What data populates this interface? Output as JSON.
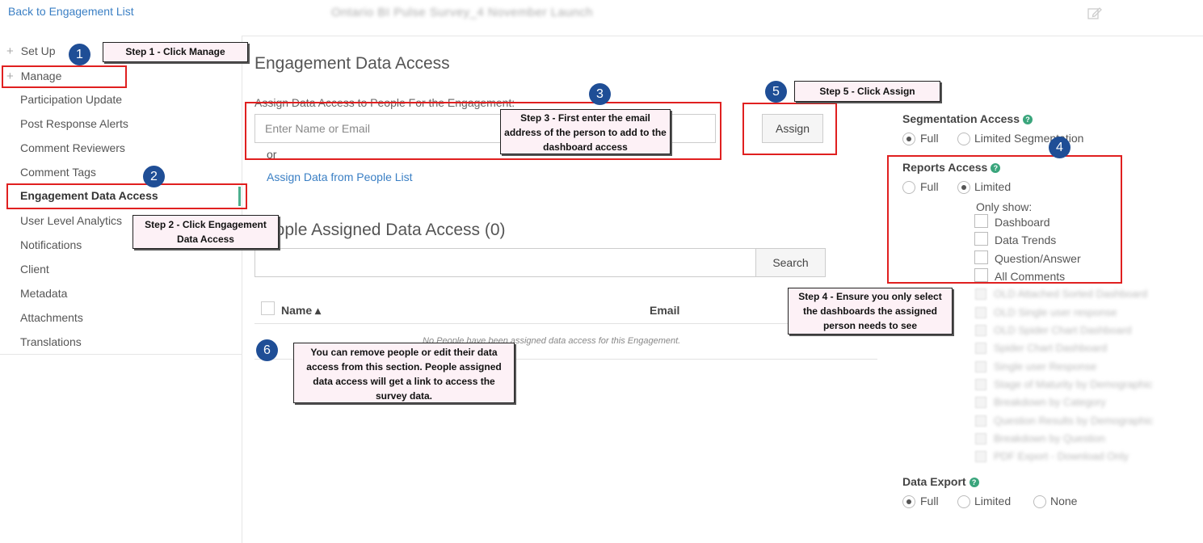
{
  "header": {
    "back_link": "Back to Engagement List",
    "engagement_title": "Ontario BI Pulse Survey_4 November Launch"
  },
  "sidebar": {
    "setup_label": "Set Up",
    "manage_label": "Manage",
    "items": [
      {
        "label": "Participation Update"
      },
      {
        "label": "Post Response Alerts"
      },
      {
        "label": "Comment Reviewers"
      },
      {
        "label": "Comment Tags"
      },
      {
        "label": "Engagement Data Access"
      },
      {
        "label": "User Level Analytics"
      },
      {
        "label": "Notifications"
      },
      {
        "label": "Client"
      },
      {
        "label": "Metadata"
      },
      {
        "label": "Attachments"
      },
      {
        "label": "Translations"
      }
    ]
  },
  "main": {
    "title": "Engagement Data Access",
    "assign_label": "Assign Data Access to People For the Engagement:",
    "name_placeholder": "Enter Name or Email",
    "assign_button": "Assign",
    "or_text": "or",
    "assign_from_list": "Assign Data from People List",
    "people_title": "People Assigned Data Access (0)",
    "search_button": "Search",
    "columns": {
      "name": "Name ▴",
      "email": "Email"
    },
    "empty_message": "No People have been assigned data access for this Engagement."
  },
  "right_panel": {
    "segmentation": {
      "title": "Segmentation Access",
      "full": "Full",
      "limited": "Limited Segmentation"
    },
    "reports": {
      "title": "Reports Access",
      "full": "Full",
      "limited": "Limited",
      "only_show": "Only show:",
      "checkboxes": [
        {
          "label": "Dashboard"
        },
        {
          "label": "Data Trends"
        },
        {
          "label": "Question/Answer"
        },
        {
          "label": "All Comments"
        }
      ],
      "blurred_items": [
        {
          "label": "OLD Attached Sorted Dashboard"
        },
        {
          "label": "OLD Single user response"
        },
        {
          "label": "OLD Spider Chart Dashboard"
        },
        {
          "label": "Spider Chart Dashboard"
        },
        {
          "label": "Single user Response"
        },
        {
          "label": "Stage of Maturity by Demographic"
        },
        {
          "label": "Breakdown by Category"
        },
        {
          "label": "Question Results by Demographic"
        },
        {
          "label": "Breakdown by Question"
        },
        {
          "label": "PDF Export - Download Only"
        }
      ]
    },
    "data_export": {
      "title": "Data Export",
      "full": "Full",
      "limited": "Limited",
      "none": "None"
    }
  },
  "annotations": {
    "step1": "Step 1 - Click Manage",
    "step2": "Step 2 - Click Engagement Data Access",
    "step3": "Step 3 - First enter the email address of the person to add to the dashboard access",
    "step4": "Step 4 - Ensure you only select the dashboards the assigned person needs to see",
    "step5": "Step 5 - Click Assign",
    "step6": "You can remove people or edit their data access from this section. People assigned data access will get a link to access the survey data.",
    "badges": [
      "1",
      "2",
      "3",
      "4",
      "5",
      "6"
    ]
  },
  "colors": {
    "link": "#3a7fc4",
    "accent_green": "#4caf8e",
    "annotation_red": "#e02020",
    "badge_blue": "#1f4e96"
  }
}
